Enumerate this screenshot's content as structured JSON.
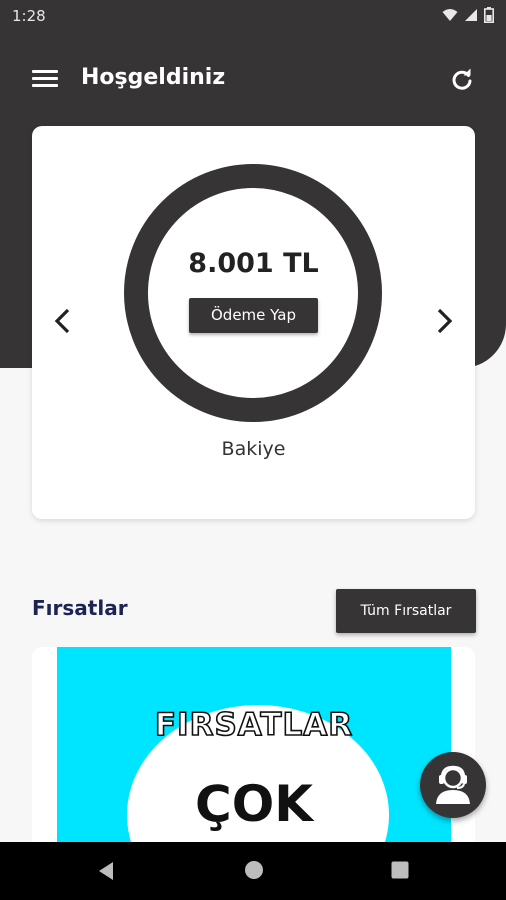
{
  "status_bar": {
    "time": "1:28",
    "icons": [
      "wifi-icon",
      "signal-icon",
      "battery-icon"
    ]
  },
  "app_bar": {
    "title": "Hoşgeldiniz",
    "menu_icon": "menu-icon",
    "refresh_icon": "refresh-icon"
  },
  "balance_card": {
    "amount": "8.001 TL",
    "pay_button": "Ödeme Yap",
    "label": "Bakiye",
    "prev_icon": "chevron-left-icon",
    "next_icon": "chevron-right-icon"
  },
  "deals": {
    "title": "Fırsatlar",
    "all_button": "Tüm Fırsatlar",
    "banner": {
      "headline": "FIRSATLAR",
      "big_text": "ÇOK"
    }
  },
  "support_fab": {
    "icon": "support-agent-icon"
  },
  "android_nav": {
    "back_icon": "back-icon",
    "home_icon": "home-icon",
    "recents_icon": "recents-icon"
  },
  "colors": {
    "header": "#363435",
    "accent_title": "#1d2454",
    "banner": "#00e5ff",
    "background": "#f7f7f7"
  }
}
